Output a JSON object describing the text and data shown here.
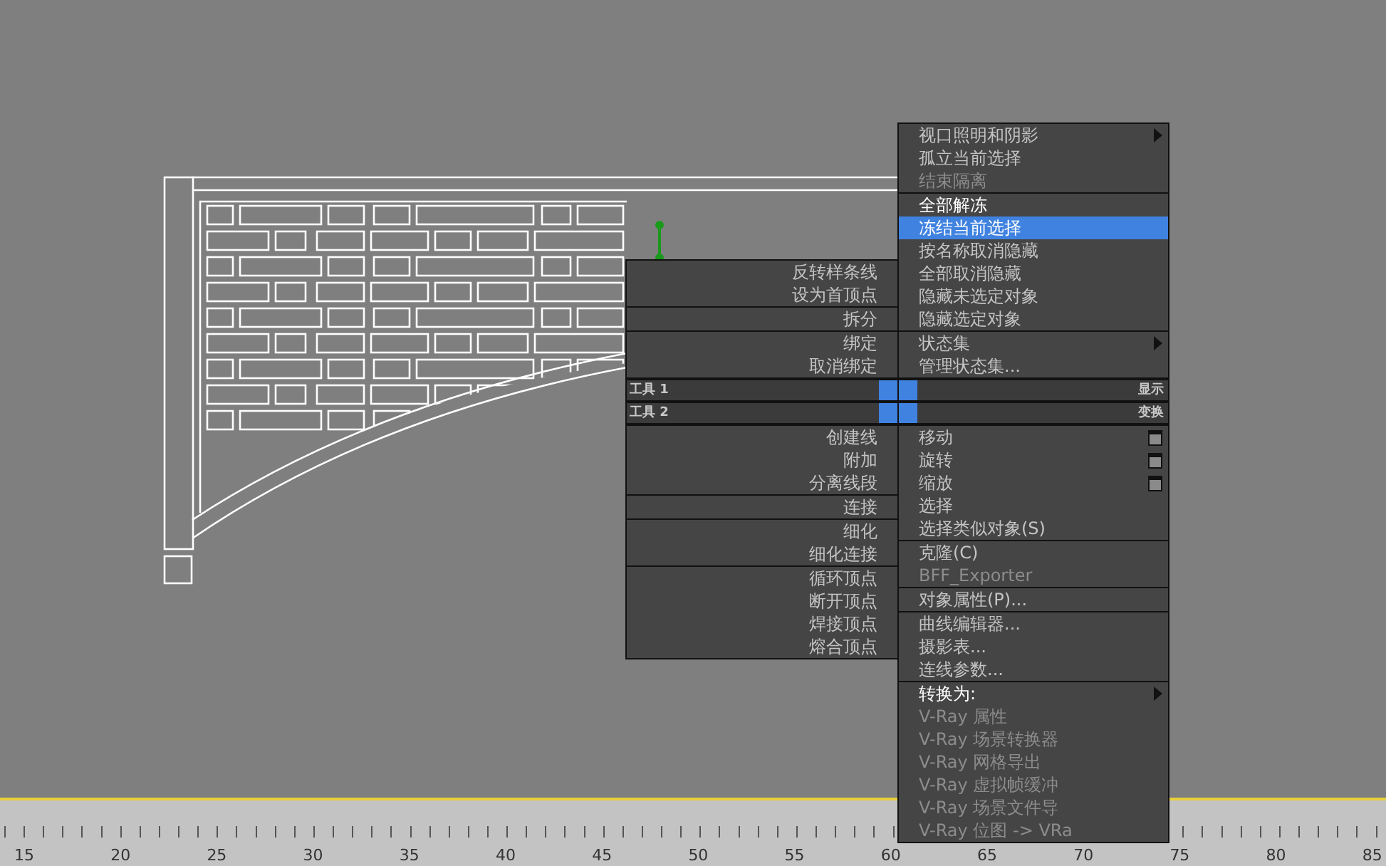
{
  "quad_menu": {
    "upper_right": {
      "title": "显示",
      "groups": [
        [
          {
            "label": "视口照明和阴影",
            "selected": false,
            "disabled": false,
            "bright": false,
            "submenu": true,
            "has_options": false
          },
          {
            "label": "孤立当前选择",
            "selected": false,
            "disabled": false,
            "bright": false,
            "submenu": false,
            "has_options": false
          },
          {
            "label": "结束隔离",
            "selected": false,
            "disabled": true,
            "bright": false,
            "submenu": false,
            "has_options": false
          }
        ],
        [
          {
            "label": "全部解冻",
            "selected": false,
            "disabled": false,
            "bright": true,
            "submenu": false,
            "has_options": false
          },
          {
            "label": "冻结当前选择",
            "selected": true,
            "disabled": false,
            "bright": false,
            "submenu": false,
            "has_options": false
          },
          {
            "label": "按名称取消隐藏",
            "selected": false,
            "disabled": false,
            "bright": false,
            "submenu": false,
            "has_options": false
          },
          {
            "label": "全部取消隐藏",
            "selected": false,
            "disabled": false,
            "bright": false,
            "submenu": false,
            "has_options": false
          },
          {
            "label": "隐藏未选定对象",
            "selected": false,
            "disabled": false,
            "bright": false,
            "submenu": false,
            "has_options": false
          },
          {
            "label": "隐藏选定对象",
            "selected": false,
            "disabled": false,
            "bright": false,
            "submenu": false,
            "has_options": false
          }
        ],
        [
          {
            "label": "状态集",
            "selected": false,
            "disabled": false,
            "bright": false,
            "submenu": true,
            "has_options": false
          },
          {
            "label": "管理状态集...",
            "selected": false,
            "disabled": false,
            "bright": false,
            "submenu": false,
            "has_options": false
          }
        ]
      ]
    },
    "upper_left": {
      "title": "工具 1",
      "groups": [
        [
          {
            "label": "反转样条线",
            "selected": false,
            "disabled": false,
            "bright": false,
            "submenu": false,
            "has_options": false
          },
          {
            "label": "设为首顶点",
            "selected": false,
            "disabled": false,
            "bright": false,
            "submenu": false,
            "has_options": false
          }
        ],
        [
          {
            "label": "拆分",
            "selected": false,
            "disabled": false,
            "bright": false,
            "submenu": false,
            "has_options": false
          }
        ],
        [
          {
            "label": "绑定",
            "selected": false,
            "disabled": false,
            "bright": false,
            "submenu": false,
            "has_options": false
          },
          {
            "label": "取消绑定",
            "selected": false,
            "disabled": false,
            "bright": false,
            "submenu": false,
            "has_options": false
          }
        ]
      ]
    },
    "lower_left": {
      "title": "工具 2",
      "groups": [
        [
          {
            "label": "创建线",
            "selected": false,
            "disabled": false,
            "bright": false,
            "submenu": false,
            "has_options": false
          },
          {
            "label": "附加",
            "selected": false,
            "disabled": false,
            "bright": false,
            "submenu": false,
            "has_options": false
          },
          {
            "label": "分离线段",
            "selected": false,
            "disabled": false,
            "bright": false,
            "submenu": false,
            "has_options": false
          }
        ],
        [
          {
            "label": "连接",
            "selected": false,
            "disabled": false,
            "bright": false,
            "submenu": false,
            "has_options": false
          }
        ],
        [
          {
            "label": "细化",
            "selected": false,
            "disabled": false,
            "bright": false,
            "submenu": false,
            "has_options": false
          },
          {
            "label": "细化连接",
            "selected": false,
            "disabled": false,
            "bright": false,
            "submenu": false,
            "has_options": false
          }
        ],
        [
          {
            "label": "循环顶点",
            "selected": false,
            "disabled": false,
            "bright": false,
            "submenu": false,
            "has_options": false
          },
          {
            "label": "断开顶点",
            "selected": false,
            "disabled": false,
            "bright": false,
            "submenu": false,
            "has_options": false
          },
          {
            "label": "焊接顶点",
            "selected": false,
            "disabled": false,
            "bright": false,
            "submenu": false,
            "has_options": false
          },
          {
            "label": "熔合顶点",
            "selected": false,
            "disabled": false,
            "bright": false,
            "submenu": false,
            "has_options": false
          }
        ]
      ]
    },
    "lower_right": {
      "title": "变换",
      "groups": [
        [
          {
            "label": "移动",
            "selected": false,
            "disabled": false,
            "bright": false,
            "submenu": false,
            "has_options": true
          },
          {
            "label": "旋转",
            "selected": false,
            "disabled": false,
            "bright": false,
            "submenu": false,
            "has_options": true
          },
          {
            "label": "缩放",
            "selected": false,
            "disabled": false,
            "bright": false,
            "submenu": false,
            "has_options": true
          },
          {
            "label": "选择",
            "selected": false,
            "disabled": false,
            "bright": false,
            "submenu": false,
            "has_options": false
          },
          {
            "label": "选择类似对象(S)",
            "selected": false,
            "disabled": false,
            "bright": false,
            "submenu": false,
            "has_options": false
          }
        ],
        [
          {
            "label": "克隆(C)",
            "selected": false,
            "disabled": false,
            "bright": false,
            "submenu": false,
            "has_options": false
          },
          {
            "label": "BFF_Exporter",
            "selected": false,
            "disabled": true,
            "bright": false,
            "submenu": false,
            "has_options": false
          }
        ],
        [
          {
            "label": "对象属性(P)...",
            "selected": false,
            "disabled": false,
            "bright": false,
            "submenu": false,
            "has_options": false
          }
        ],
        [
          {
            "label": "曲线编辑器...",
            "selected": false,
            "disabled": false,
            "bright": false,
            "submenu": false,
            "has_options": false
          },
          {
            "label": "摄影表...",
            "selected": false,
            "disabled": false,
            "bright": false,
            "submenu": false,
            "has_options": false
          },
          {
            "label": "连线参数...",
            "selected": false,
            "disabled": false,
            "bright": false,
            "submenu": false,
            "has_options": false
          }
        ],
        [
          {
            "label": "转换为:",
            "selected": false,
            "disabled": false,
            "bright": true,
            "submenu": true,
            "has_options": false
          },
          {
            "label": "V-Ray 属性",
            "selected": false,
            "disabled": true,
            "bright": false,
            "submenu": false,
            "has_options": false
          },
          {
            "label": "V-Ray 场景转换器",
            "selected": false,
            "disabled": true,
            "bright": false,
            "submenu": false,
            "has_options": false
          },
          {
            "label": "V-Ray 网格导出",
            "selected": false,
            "disabled": true,
            "bright": false,
            "submenu": false,
            "has_options": false
          },
          {
            "label": "V-Ray 虚拟帧缓冲",
            "selected": false,
            "disabled": true,
            "bright": false,
            "submenu": false,
            "has_options": false
          },
          {
            "label": "V-Ray 场景文件导",
            "selected": false,
            "disabled": true,
            "bright": false,
            "submenu": false,
            "has_options": false
          },
          {
            "label": "V-Ray 位图 -> VRa",
            "selected": false,
            "disabled": true,
            "bright": false,
            "submenu": false,
            "has_options": false
          }
        ]
      ]
    }
  },
  "time_ruler": {
    "labels": [
      "15",
      "20",
      "25",
      "30",
      "35",
      "40",
      "45",
      "50",
      "55",
      "60",
      "65",
      "70",
      "75",
      "80",
      "85"
    ]
  }
}
